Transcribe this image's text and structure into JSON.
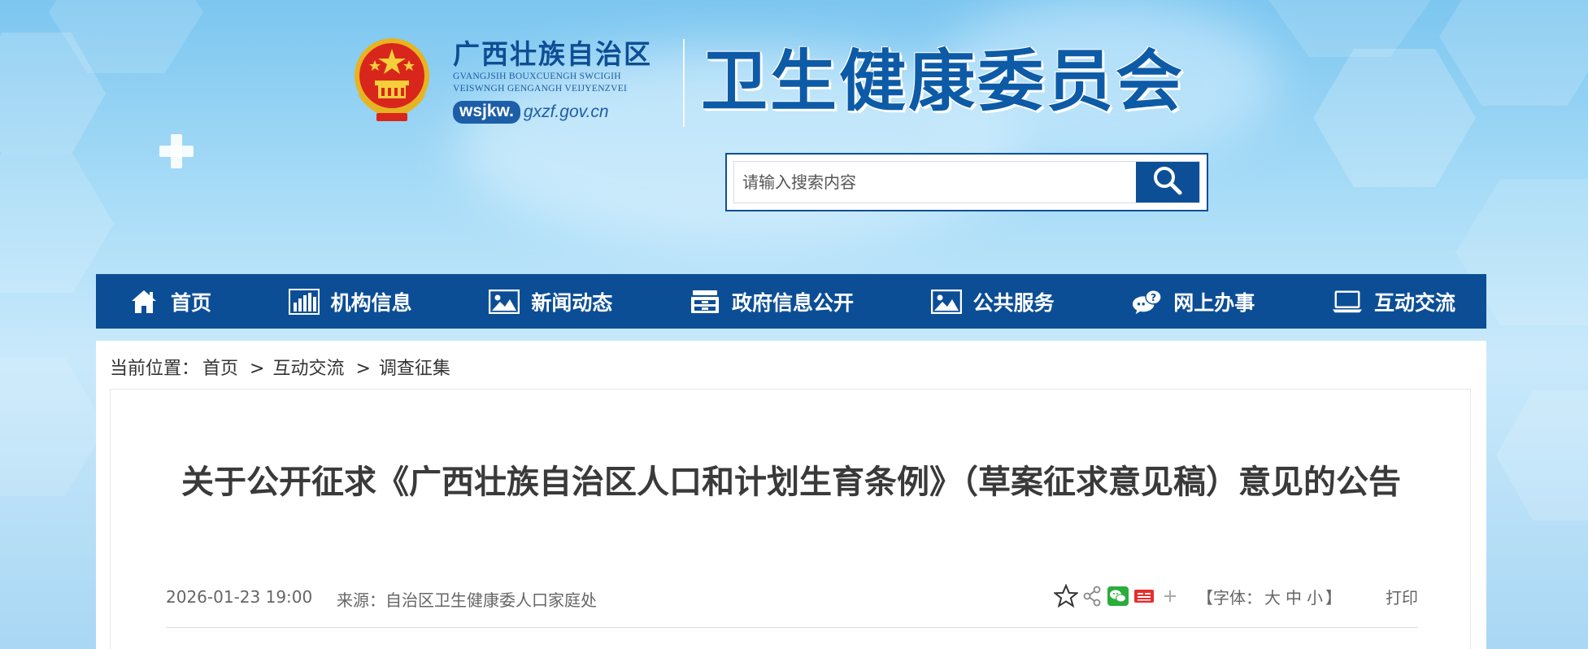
{
  "header": {
    "org_name_cn": "广西壮族自治区",
    "org_name_latin_1": "GVANGJSIH BOUXCUENGH SWCIGIH",
    "org_name_latin_2": "VEISWNGH GENGANGH VEIJYENZVEI",
    "domain_badge": "wsjkw.",
    "domain_rest": "gxzf.gov.cn",
    "site_title": "卫生健康委员会",
    "emblem": "national-emblem"
  },
  "search": {
    "placeholder": "请输入搜索内容",
    "value": "",
    "icon": "search-icon"
  },
  "nav": {
    "items": [
      {
        "label": "首页",
        "icon": "home-icon"
      },
      {
        "label": "机构信息",
        "icon": "bar-chart-icon"
      },
      {
        "label": "新闻动态",
        "icon": "image-icon"
      },
      {
        "label": "政府信息公开",
        "icon": "cabinet-icon"
      },
      {
        "label": "公共服务",
        "icon": "image-icon"
      },
      {
        "label": "网上办事",
        "icon": "chat-help-icon"
      },
      {
        "label": "互动交流",
        "icon": "laptop-icon"
      }
    ]
  },
  "breadcrumb": {
    "prefix": "当前位置：",
    "items": [
      "首页",
      "互动交流",
      "调查征集"
    ],
    "separator": ">"
  },
  "article": {
    "title": "关于公开征求《广西壮族自治区人口和计划生育条例》（草案征求意见稿）意见的公告",
    "date": "2026-01-23 19:00",
    "source_label": "来源：",
    "source": "自治区卫生健康委人口家庭处",
    "font_label_open": "【字体：",
    "font_sizes": [
      "大",
      "中",
      "小"
    ],
    "font_label_close": "】",
    "print": "打印",
    "share_icons": [
      "star-icon",
      "share-icon",
      "wechat-icon",
      "toutiao-icon",
      "plus-icon"
    ]
  },
  "colors": {
    "nav_bg": "#0c4e96",
    "title_blue": "#0d5ba7",
    "search_border": "#0d4f97"
  }
}
